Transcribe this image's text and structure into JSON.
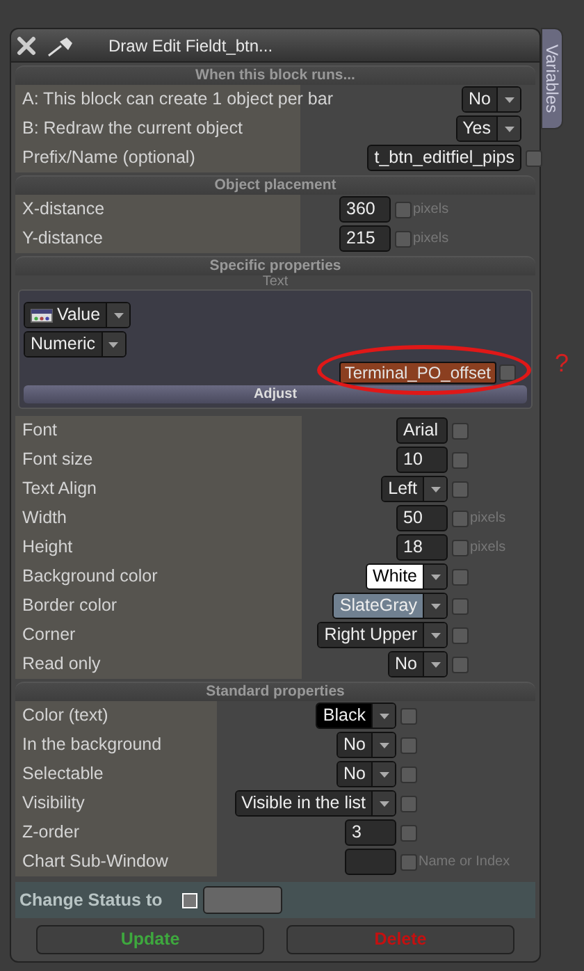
{
  "window": {
    "title": "Draw Edit Fieldt_btn...",
    "side_tab": "Variables"
  },
  "sections": [
    {
      "kind": "block",
      "title": "When this block runs...",
      "rows": [
        {
          "label": "A: This block can create 1 object per bar",
          "control": {
            "kind": "dropdown",
            "value": "No"
          }
        },
        {
          "label": "B: Redraw the current object",
          "control": {
            "kind": "dropdown",
            "value": "Yes"
          }
        },
        {
          "label": "Prefix/Name (optional)",
          "control": {
            "kind": "input",
            "value": "t_btn_editfiel_pips"
          },
          "checked": false
        }
      ]
    },
    {
      "kind": "placement",
      "title": "Object placement",
      "rows": [
        {
          "label": "X-distance",
          "control": {
            "kind": "input",
            "value": "360"
          },
          "checked": false,
          "unit": "pixels"
        },
        {
          "label": "Y-distance",
          "control": {
            "kind": "input",
            "value": "215"
          },
          "checked": false,
          "unit": "pixels"
        }
      ]
    },
    {
      "kind": "properties",
      "title": "Specific properties",
      "subtitle": "Text",
      "text_panel": {
        "source": "Value",
        "format": "Numeric",
        "variable": "Terminal_PO_offset",
        "checked": false,
        "button": "Adjust",
        "annotation": "?"
      },
      "rows": [
        {
          "label": "Font",
          "control": {
            "kind": "input",
            "value": "Arial"
          },
          "checked": false
        },
        {
          "label": "Font size",
          "control": {
            "kind": "input",
            "value": "10"
          },
          "checked": false
        },
        {
          "label": "Text Align",
          "control": {
            "kind": "dropdown",
            "value": "Left"
          },
          "checked": false
        },
        {
          "label": "Width",
          "control": {
            "kind": "input",
            "value": "50"
          },
          "checked": false,
          "unit": "pixels"
        },
        {
          "label": "Height",
          "control": {
            "kind": "input",
            "value": "18"
          },
          "checked": false,
          "unit": "pixels"
        },
        {
          "label": "Background color",
          "control": {
            "kind": "dropdown",
            "value": "White",
            "color": "#ffffff"
          },
          "checked": false
        },
        {
          "label": "Border color",
          "control": {
            "kind": "dropdown",
            "value": "SlateGray",
            "color": "#708090"
          },
          "checked": false
        },
        {
          "label": "Corner",
          "control": {
            "kind": "dropdown",
            "value": "Right Upper"
          },
          "checked": false
        },
        {
          "label": "Read only",
          "control": {
            "kind": "dropdown",
            "value": "No"
          },
          "checked": false
        }
      ]
    },
    {
      "kind": "standard",
      "title": "Standard properties",
      "rows": [
        {
          "label": "Color (text)",
          "control": {
            "kind": "dropdown",
            "value": "Black",
            "color": "#000000"
          },
          "checked": false
        },
        {
          "label": "In the background",
          "control": {
            "kind": "dropdown",
            "value": "No"
          },
          "checked": false
        },
        {
          "label": "Selectable",
          "control": {
            "kind": "dropdown",
            "value": "No"
          },
          "checked": false
        },
        {
          "label": "Visibility",
          "control": {
            "kind": "dropdown",
            "value": "Visible in the list"
          },
          "checked": false
        },
        {
          "label": "Z-order",
          "control": {
            "kind": "input",
            "value": "3"
          },
          "checked": false
        },
        {
          "label": "Chart Sub-Window",
          "control": {
            "kind": "input"
          },
          "checked": false,
          "unit": "Name or Index"
        }
      ]
    }
  ],
  "change_status": {
    "label": "Change Status to",
    "checked": false
  },
  "buttons": [
    {
      "label": "Update",
      "kind": "update"
    },
    {
      "label": "Delete",
      "kind": "delete"
    }
  ]
}
